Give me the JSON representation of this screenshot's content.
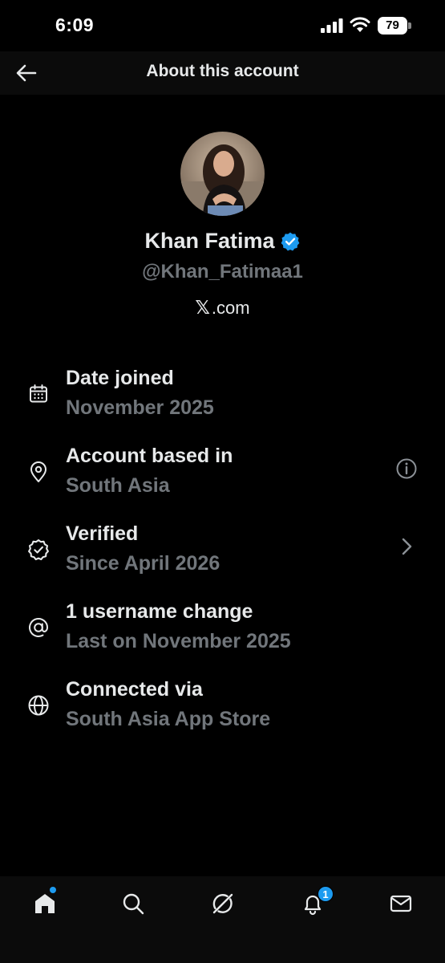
{
  "status_bar": {
    "time": "6:09",
    "battery_level": "79"
  },
  "header": {
    "title": "About this account",
    "back_icon": "arrow-left-icon"
  },
  "profile": {
    "display_name": "Khan Fatima",
    "handle": "@Khan_Fatimaa1",
    "site_glyph": "𝕏",
    "site_text": ".com",
    "verified": true,
    "verified_color": "#1d9bf0"
  },
  "info_rows": [
    {
      "icon": "calendar-icon",
      "title": "Date joined",
      "subtitle": "November 2025",
      "trailing": null
    },
    {
      "icon": "location-pin-icon",
      "title": "Account based in",
      "subtitle": "South Asia",
      "trailing": "info-icon"
    },
    {
      "icon": "verified-badge-outline-icon",
      "title": "Verified",
      "subtitle": "Since April 2026",
      "trailing": "chevron-right-icon"
    },
    {
      "icon": "at-sign-icon",
      "title": "1 username change",
      "subtitle": "Last on November 2025",
      "trailing": null
    },
    {
      "icon": "globe-icon",
      "title": "Connected via",
      "subtitle": "South Asia App Store",
      "trailing": null
    }
  ],
  "bottom_nav": {
    "items": [
      "home-icon",
      "search-icon",
      "grok-icon",
      "notifications-icon",
      "messages-icon"
    ],
    "notification_count": "1",
    "accent_color": "#1d9bf0"
  },
  "colors": {
    "background": "#000000",
    "primary_text": "#e7e9ea",
    "secondary_text": "#71767b",
    "accent": "#1d9bf0"
  }
}
